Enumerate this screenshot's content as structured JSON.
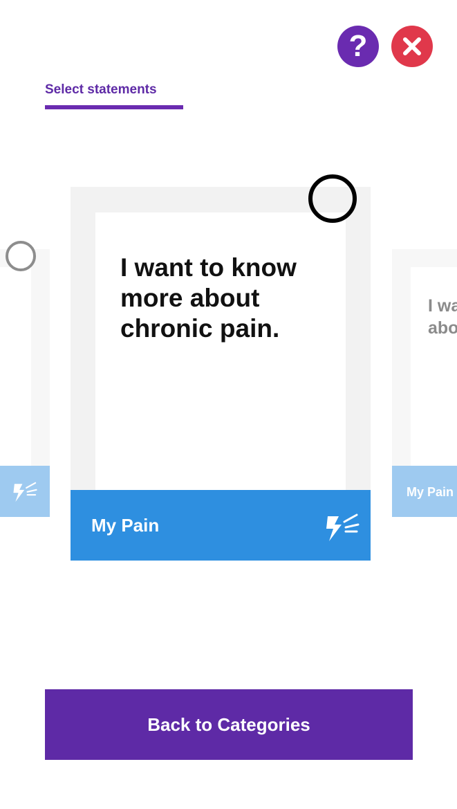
{
  "header": {
    "help_label": "?",
    "close_icon": "close-icon",
    "help_color": "#6a2bb0",
    "close_color": "#e0384b"
  },
  "tab": {
    "label": "Select statements"
  },
  "cards": {
    "left": {
      "icon": "lightning-icon"
    },
    "main": {
      "statement": "I want to know more about chronic pain.",
      "category": "My Pain",
      "icon": "lightning-icon",
      "footer_color": "#2e8fe0"
    },
    "right": {
      "statement": "I want to know more about chronic pain.",
      "category": "My Pain"
    }
  },
  "footer": {
    "back_label": "Back to Categories",
    "button_color": "#5e2aa6"
  }
}
